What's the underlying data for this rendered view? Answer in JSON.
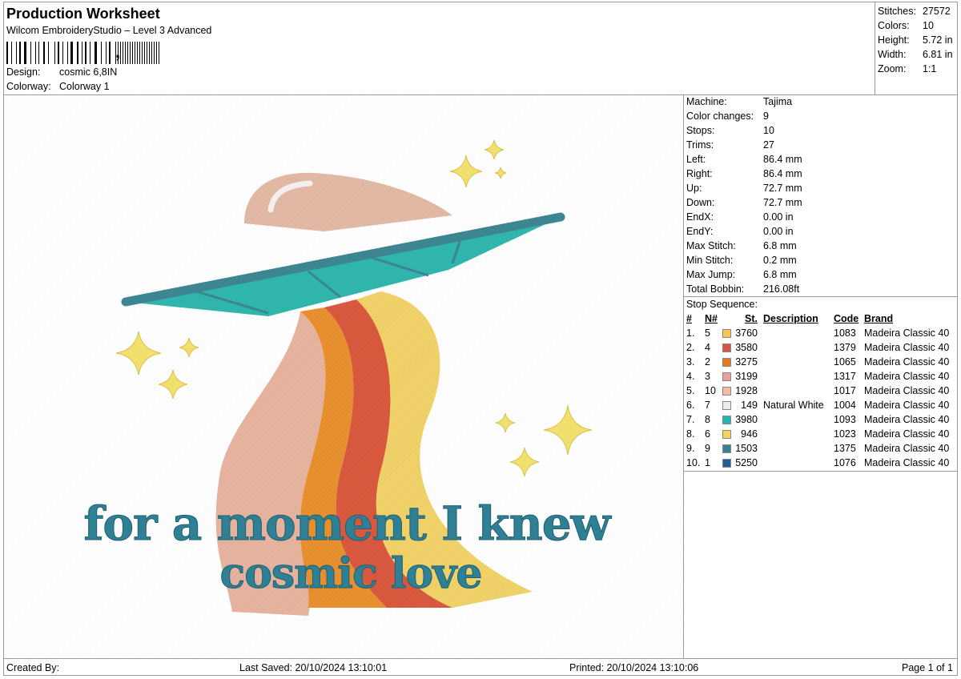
{
  "header": {
    "title": "Production Worksheet",
    "subtitle": "Wilcom EmbroideryStudio – Level 3 Advanced",
    "barcode_suffix": ",",
    "design_label": "Design:",
    "design_value": "cosmic 6,8IN",
    "colorway_label": "Colorway:",
    "colorway_value": "Colorway 1"
  },
  "stats": [
    {
      "label": "Stitches:",
      "value": "27572"
    },
    {
      "label": "Colors:",
      "value": "10"
    },
    {
      "label": "Height:",
      "value": "5.72 in"
    },
    {
      "label": "Width:",
      "value": "6.81 in"
    },
    {
      "label": "Zoom:",
      "value": "1:1"
    }
  ],
  "machine_info": [
    {
      "label": "Machine:",
      "value": "Tajima"
    },
    {
      "label": "Color changes:",
      "value": "9"
    },
    {
      "label": "Stops:",
      "value": "10"
    },
    {
      "label": "Trims:",
      "value": "27"
    },
    {
      "label": "Left:",
      "value": "86.4 mm"
    },
    {
      "label": "Right:",
      "value": "86.4 mm"
    },
    {
      "label": "Up:",
      "value": "72.7 mm"
    },
    {
      "label": "Down:",
      "value": "72.7 mm"
    },
    {
      "label": "EndX:",
      "value": "0.00 in"
    },
    {
      "label": "EndY:",
      "value": "0.00 in"
    },
    {
      "label": "Max Stitch:",
      "value": "6.8 mm"
    },
    {
      "label": "Min Stitch:",
      "value": "0.2 mm"
    },
    {
      "label": "Max Jump:",
      "value": "6.8 mm"
    },
    {
      "label": "Total Bobbin:",
      "value": "216.08ft"
    }
  ],
  "stop_sequence": {
    "title": "Stop Sequence:",
    "headers": {
      "num": "#",
      "n": "N#",
      "st": "St.",
      "description": "Description",
      "code": "Code",
      "brand": "Brand"
    },
    "rows": [
      {
        "num": "1.",
        "n": "5",
        "color": "#f5c454",
        "st": "3760",
        "description": "",
        "code": "1083",
        "brand": "Madeira Classic 40"
      },
      {
        "num": "2.",
        "n": "4",
        "color": "#d9533f",
        "st": "3580",
        "description": "",
        "code": "1379",
        "brand": "Madeira Classic 40"
      },
      {
        "num": "3.",
        "n": "2",
        "color": "#e07a24",
        "st": "3275",
        "description": "",
        "code": "1065",
        "brand": "Madeira Classic 40"
      },
      {
        "num": "4.",
        "n": "3",
        "color": "#e8a09a",
        "st": "3199",
        "description": "",
        "code": "1317",
        "brand": "Madeira Classic 40"
      },
      {
        "num": "5.",
        "n": "10",
        "color": "#f2b9a5",
        "st": "1928",
        "description": "",
        "code": "1017",
        "brand": "Madeira Classic 40"
      },
      {
        "num": "6.",
        "n": "7",
        "color": "#ececec",
        "st": "149",
        "description": "Natural White",
        "code": "1004",
        "brand": "Madeira Classic 40"
      },
      {
        "num": "7.",
        "n": "8",
        "color": "#22b5b0",
        "st": "3980",
        "description": "",
        "code": "1093",
        "brand": "Madeira Classic 40"
      },
      {
        "num": "8.",
        "n": "6",
        "color": "#f0d55a",
        "st": "946",
        "description": "",
        "code": "1023",
        "brand": "Madeira Classic 40"
      },
      {
        "num": "9.",
        "n": "9",
        "color": "#3a7f94",
        "st": "1503",
        "description": "",
        "code": "1375",
        "brand": "Madeira Classic 40"
      },
      {
        "num": "10.",
        "n": "1",
        "color": "#1f5f9a",
        "st": "5250",
        "description": "",
        "code": "1076",
        "brand": "Madeira Classic 40"
      }
    ]
  },
  "design": {
    "line1": "for a moment I knew",
    "line2": "cosmic love"
  },
  "footer": {
    "created_by": "Created By:",
    "last_saved": "Last Saved: 20/10/2024 13:10:01",
    "printed": "Printed: 20/10/2024 13:10:06",
    "page": "Page 1 of 1"
  }
}
